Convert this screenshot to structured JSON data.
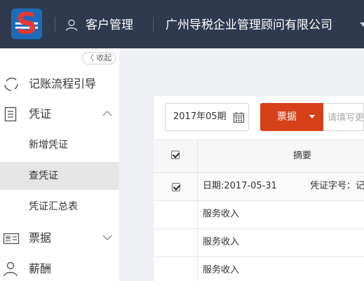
{
  "header": {
    "customer_label": "客户管理",
    "company_name": "广州导税企业管理顾问有限公司"
  },
  "sidebar": {
    "collapse_label": "〈 收起",
    "items": [
      {
        "label": "记账流程引导",
        "icon": "process-guide-icon"
      },
      {
        "label": "凭证",
        "icon": "voucher-icon",
        "expanded": true
      },
      {
        "label": "新增凭证"
      },
      {
        "label": "查凭证",
        "active": true
      },
      {
        "label": "凭证汇总表"
      },
      {
        "label": "票据",
        "icon": "invoice-icon",
        "expanded": false
      },
      {
        "label": "薪酬",
        "icon": "salary-icon"
      }
    ]
  },
  "toolbar": {
    "period": "2017年05期",
    "type_button": "票据",
    "search_placeholder": "请填写更"
  },
  "table": {
    "header": {
      "summary": "摘要",
      "checked": true
    },
    "voucher_row": {
      "date": "日期:2017-05-31",
      "voucher_no": "凭证字号：记",
      "checked": true
    },
    "entries": [
      "服务收入",
      "服务收入",
      "服务收入"
    ]
  },
  "colors": {
    "topbar": "#2f3a4e",
    "accent": "#d64119",
    "active_bg": "#e5e5e5"
  }
}
